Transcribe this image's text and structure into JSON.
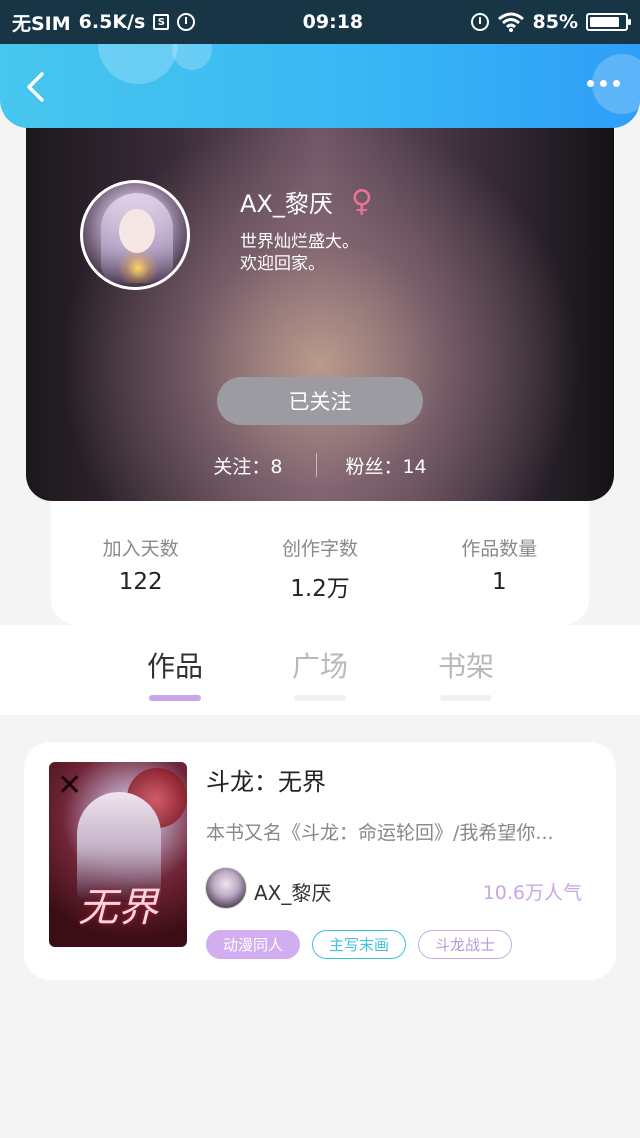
{
  "status_bar": {
    "carrier": "无SIM",
    "speed": "6.5K/s",
    "sim_icon_text": "S",
    "time": "09:18",
    "battery": "85%",
    "battery_level": 0.85
  },
  "header": {
    "back_icon": "chevron-left-icon",
    "more_icon": "more-dots-icon"
  },
  "profile": {
    "username": "AX_黎厌",
    "gender_symbol": "♀",
    "bio_line1": "世界灿烂盛大。",
    "bio_line2": "欢迎回家。",
    "follow_label": "已关注",
    "following": "关注：8",
    "fans": "粉丝：14"
  },
  "stats": [
    {
      "label": "加入天数",
      "value": "122"
    },
    {
      "label": "创作字数",
      "value": "1.2万"
    },
    {
      "label": "作品数量",
      "value": "1"
    }
  ],
  "tabs": [
    {
      "label": "作品",
      "active": true
    },
    {
      "label": "广场",
      "active": false
    },
    {
      "label": "书架",
      "active": false
    }
  ],
  "work": {
    "title": "斗龙：无界",
    "description": "本书又名《斗龙：命运轮回》/我希望你...",
    "cover_text": "无界",
    "author": "AX_黎厌",
    "popularity": "10.6万人气",
    "tags": [
      "动漫同人",
      "主写末画",
      "斗龙战士"
    ]
  },
  "colors": {
    "header_start": "#47c6ee",
    "header_end": "#2f9ef8",
    "accent_purple": "#c9a7ea",
    "tag_cyan": "#3fc3d8",
    "gender_pink": "#e87595"
  }
}
